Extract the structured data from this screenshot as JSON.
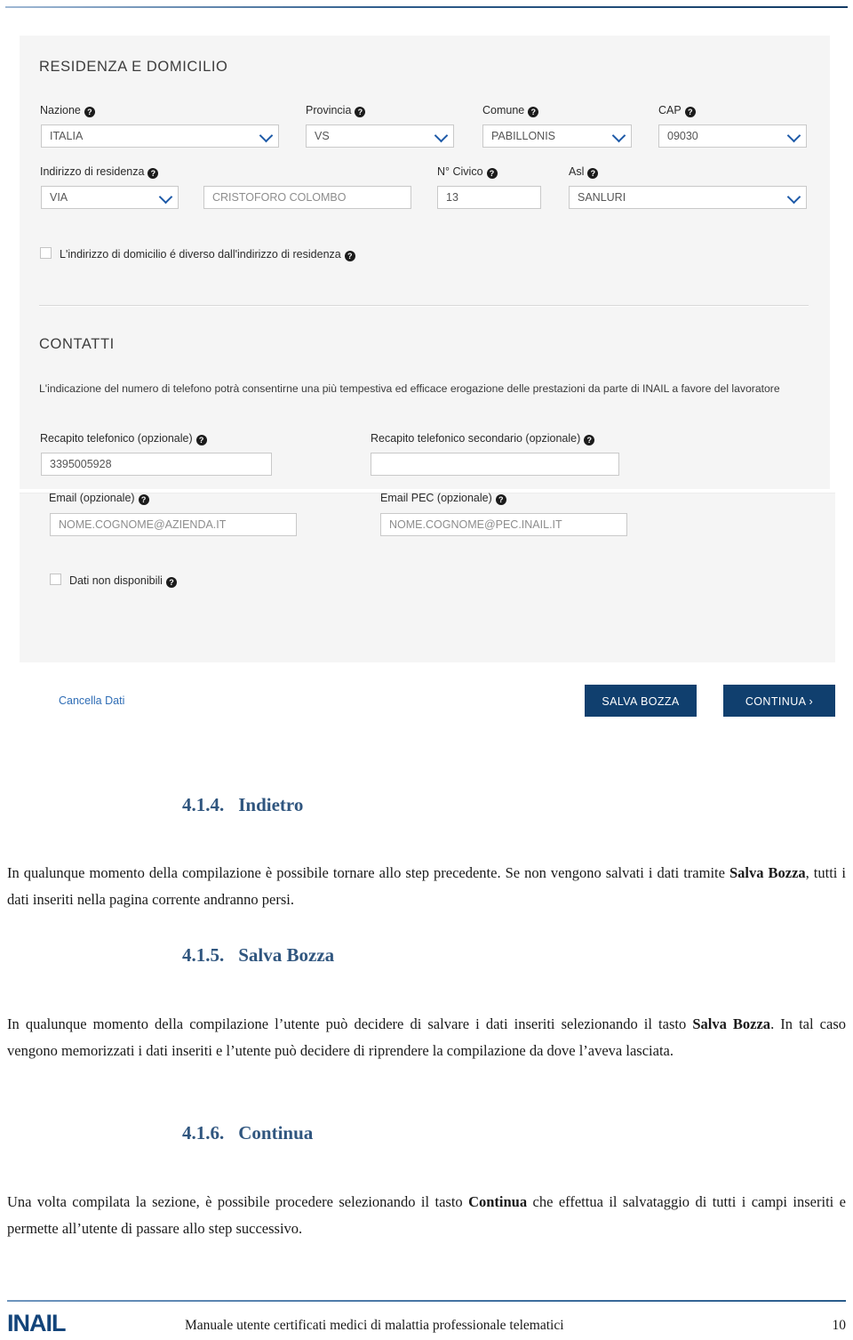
{
  "screenshot": {
    "residenza": {
      "section_title": "RESIDENZA E DOMICILIO",
      "fields": {
        "nazione_label": "Nazione",
        "nazione_value": "ITALIA",
        "provincia_label": "Provincia",
        "provincia_value": "VS",
        "comune_label": "Comune",
        "comune_value": "PABILLONIS",
        "cap_label": "CAP",
        "cap_value": "09030",
        "indirizzo_label": "Indirizzo di residenza",
        "indirizzo_tipo_value": "VIA",
        "indirizzo_via_value": "CRISTOFORO COLOMBO",
        "civico_label": "N° Civico",
        "civico_value": "13",
        "asl_label": "Asl",
        "asl_value": "SANLURI"
      },
      "checkbox_label": "L'indirizzo di domicilio é diverso dall'indirizzo di residenza"
    },
    "contatti": {
      "section_title": "CONTATTI",
      "note": "L'indicazione del numero di telefono potrà consentirne una più tempestiva ed efficace erogazione delle prestazioni da parte di INAIL a favore del lavoratore",
      "fields": {
        "tel_label": "Recapito telefonico (opzionale)",
        "tel_value": "3395005928",
        "tel2_label": "Recapito telefonico secondario (opzionale)",
        "tel2_value": "",
        "email_label": "Email (opzionale)",
        "email_value": "NOME.COGNOME@AZIENDA.IT",
        "pec_label": "Email PEC (opzionale)",
        "pec_value": "NOME.COGNOME@PEC.INAIL.IT"
      },
      "checkbox_label": "Dati non disponibili"
    },
    "actions": {
      "cancella": "Cancella Dati",
      "salva_bozza": "SALVA BOZZA",
      "continua": "CONTINUA ›"
    },
    "help_glyph": "?"
  },
  "document": {
    "sections": [
      {
        "number": "4.1.4.",
        "title": "Indietro",
        "p1_a": "In qualunque momento della compilazione è possibile tornare allo step precedente. Se non vengono salvati i dati tramite ",
        "p1_b": "Salva Bozza",
        "p1_c": ", tutti i dati inseriti nella pagina corrente andranno persi."
      },
      {
        "number": "4.1.5.",
        "title": "Salva Bozza",
        "p1_a": "In qualunque momento della compilazione l’utente può decidere di salvare i dati inseriti selezionando il tasto ",
        "p1_b": "Salva Bozza",
        "p1_c": ". In tal caso vengono memorizzati i dati inseriti e l’utente può decidere di riprendere la compilazione da dove l’aveva lasciata."
      },
      {
        "number": "4.1.6.",
        "title": "Continua",
        "p1_a": "Una volta compilata la sezione, è possibile procedere selezionando il tasto ",
        "p1_b": "Continua",
        "p1_c": " che effettua il salvataggio di tutti i campi inseriti e permette all’utente di passare allo step successivo."
      }
    ]
  },
  "footer": {
    "logo": "INAIL",
    "title": "Manuale utente certificati medici di malattia professionale telematici",
    "page": "10"
  }
}
